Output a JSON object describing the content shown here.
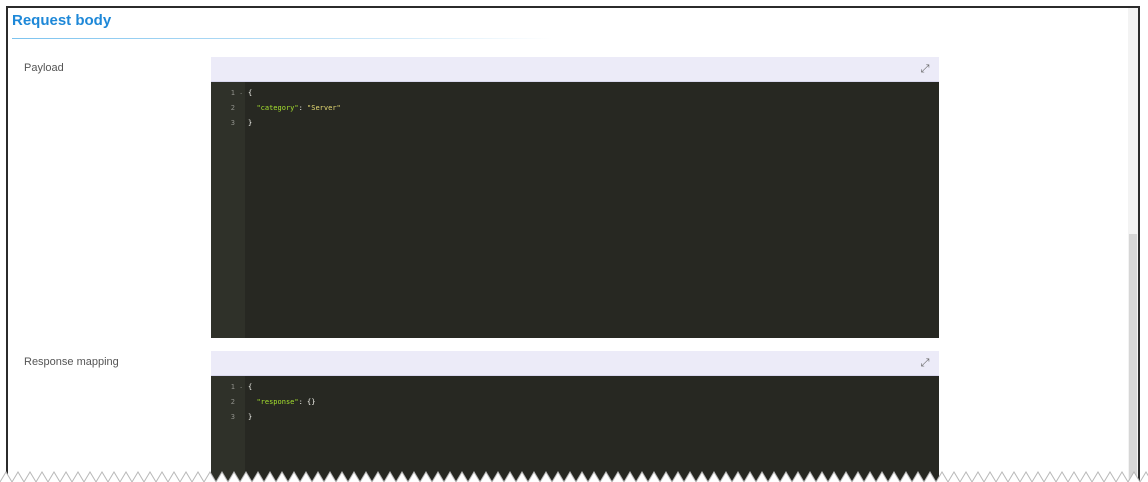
{
  "section": {
    "title": "Request body"
  },
  "fields": [
    {
      "label": "Payload",
      "code_lines": [
        {
          "num": "1",
          "fold": "-",
          "parts": [
            {
              "t": "{",
              "c": "punc"
            }
          ]
        },
        {
          "num": "2",
          "fold": "",
          "parts": [
            {
              "t": "  ",
              "c": "punc"
            },
            {
              "t": "\"category\"",
              "c": "str-key"
            },
            {
              "t": ": ",
              "c": "punc"
            },
            {
              "t": "\"Server\"",
              "c": "str-val"
            }
          ]
        },
        {
          "num": "3",
          "fold": "",
          "parts": [
            {
              "t": "}",
              "c": "punc"
            }
          ]
        }
      ]
    },
    {
      "label": "Response mapping",
      "code_lines": [
        {
          "num": "1",
          "fold": "-",
          "parts": [
            {
              "t": "{",
              "c": "punc"
            }
          ]
        },
        {
          "num": "2",
          "fold": "",
          "parts": [
            {
              "t": "  ",
              "c": "punc"
            },
            {
              "t": "\"response\"",
              "c": "str-key"
            },
            {
              "t": ": ",
              "c": "punc"
            },
            {
              "t": "{}",
              "c": "punc"
            }
          ]
        },
        {
          "num": "3",
          "fold": "",
          "parts": [
            {
              "t": "}",
              "c": "punc"
            }
          ]
        }
      ]
    }
  ],
  "icons": {
    "expand": "expand-icon"
  },
  "colors": {
    "accent": "#1e88d8",
    "editor_bg": "#272822",
    "toolbar_bg": "#ecebf8",
    "key": "#a6e22e",
    "value": "#e6db74"
  }
}
